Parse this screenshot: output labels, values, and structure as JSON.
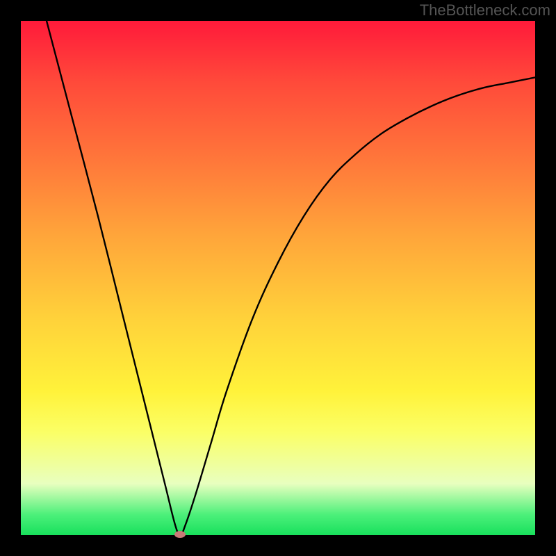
{
  "watermark": "TheBottleneck.com",
  "chart_data": {
    "type": "line",
    "title": "",
    "xlabel": "",
    "ylabel": "",
    "xlim": [
      0,
      100
    ],
    "ylim": [
      0,
      100
    ],
    "background_gradient": {
      "direction": "vertical",
      "stops": [
        {
          "pos": 0,
          "color": "#ff1a3a",
          "meaning": "high"
        },
        {
          "pos": 50,
          "color": "#ffc43a",
          "meaning": "mid"
        },
        {
          "pos": 80,
          "color": "#fbff66",
          "meaning": "low-mid"
        },
        {
          "pos": 100,
          "color": "#18e05c",
          "meaning": "low"
        }
      ]
    },
    "series": [
      {
        "name": "curve",
        "color": "#000000",
        "x": [
          5,
          10,
          15,
          20,
          25,
          28,
          30,
          31,
          32,
          34,
          37,
          40,
          45,
          50,
          55,
          60,
          65,
          70,
          75,
          80,
          85,
          90,
          95,
          100
        ],
        "values": [
          100,
          81,
          62,
          42,
          22,
          10,
          2,
          0,
          2,
          8,
          18,
          28,
          42,
          53,
          62,
          69,
          74,
          78,
          81,
          83.5,
          85.5,
          87,
          88,
          89
        ]
      }
    ],
    "marker": {
      "x": 31,
      "y": 0,
      "color": "#c97a78"
    }
  }
}
